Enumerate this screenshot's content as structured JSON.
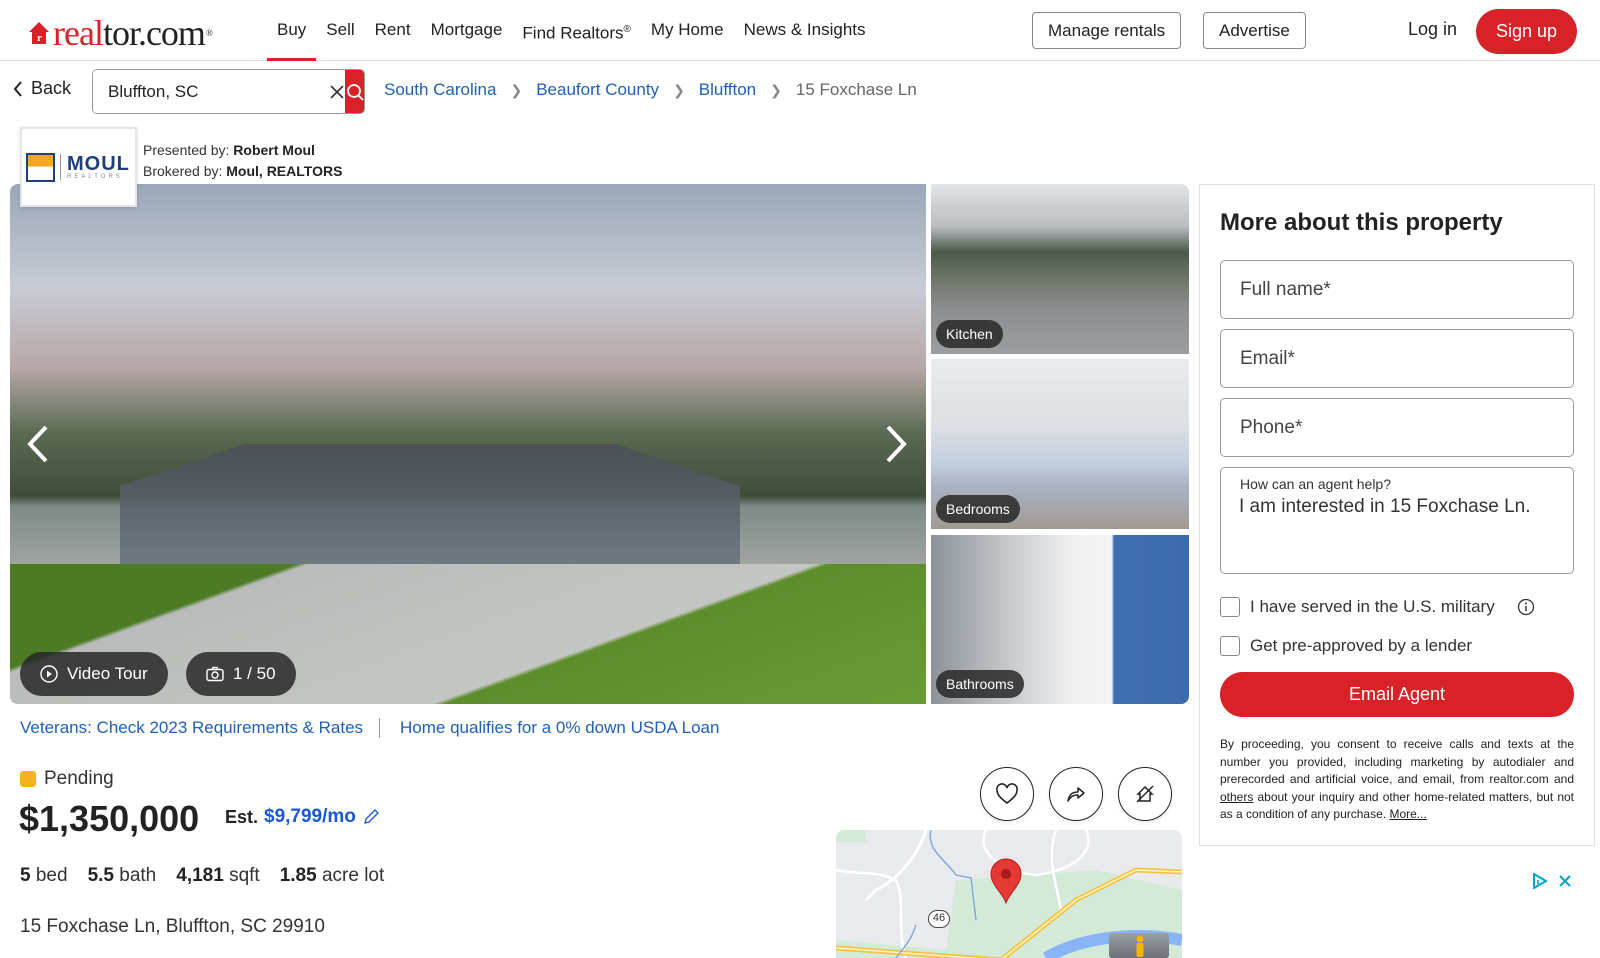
{
  "nav": {
    "logo": {
      "real": "real",
      "tor": "tor.com",
      "reg": "®"
    },
    "links": [
      {
        "label": "Buy",
        "active": true
      },
      {
        "label": "Sell"
      },
      {
        "label": "Rent"
      },
      {
        "label": "Mortgage"
      },
      {
        "label": "Find Realtors",
        "sup": "®"
      },
      {
        "label": "My Home"
      },
      {
        "label": "News & Insights"
      }
    ],
    "manage_rentals": "Manage rentals",
    "advertise": "Advertise",
    "login": "Log in",
    "signup": "Sign up"
  },
  "search": {
    "back_label": "Back",
    "value": "Bluffton, SC"
  },
  "breadcrumb": [
    "South Carolina",
    "Beaufort County",
    "Bluffton",
    "15 Foxchase Ln"
  ],
  "broker": {
    "logo_name": "MOUL",
    "logo_sub": "REALTORS",
    "presented_label": "Presented by:",
    "presented_value": "Robert Moul",
    "brokered_label": "Brokered by:",
    "brokered_value": "Moul, REALTORS"
  },
  "gallery": {
    "video_tour": "Video Tour",
    "photo_count": "1 / 50",
    "thumbs": [
      "Kitchen",
      "Bedrooms",
      "Bathrooms"
    ]
  },
  "promos": [
    "Veterans: Check 2023 Requirements & Rates",
    "Home qualifies for a 0% down USDA Loan"
  ],
  "listing": {
    "status": "Pending",
    "status_color": "#f5b21c",
    "price": "$1,350,000",
    "est_label": "Est.",
    "est_value": "$9,799/mo",
    "beds": "5",
    "beds_label": "bed",
    "baths": "5.5",
    "baths_label": "bath",
    "sqft": "4,181",
    "sqft_label": "sqft",
    "lot": "1.85",
    "lot_label": "acre lot",
    "address": "15 Foxchase Ln, Bluffton, SC 29910"
  },
  "map": {
    "route_label": "46"
  },
  "form": {
    "title": "More about this property",
    "full_name_placeholder": "Full name*",
    "email_placeholder": "Email*",
    "phone_placeholder": "Phone*",
    "message_label": "How can an agent help?",
    "message_value": "I am interested in 15 Foxchase Ln.",
    "military_label": "I have served in the U.S. military",
    "preapproved_label": "Get pre-approved by a lender",
    "submit": "Email Agent",
    "disclaimer_1": "By proceeding, you consent to receive calls and texts at the number you provided, including marketing by autodialer and prerecorded and artificial voice, and email, from realtor.com and ",
    "disclaimer_link": "others",
    "disclaimer_2": " about your inquiry and other home-related matters, but not as a condition of any purchase. ",
    "disclaimer_more": "More..."
  },
  "colors": {
    "brand": "#d92228",
    "link": "#2060b8",
    "est": "#1a57d8"
  }
}
